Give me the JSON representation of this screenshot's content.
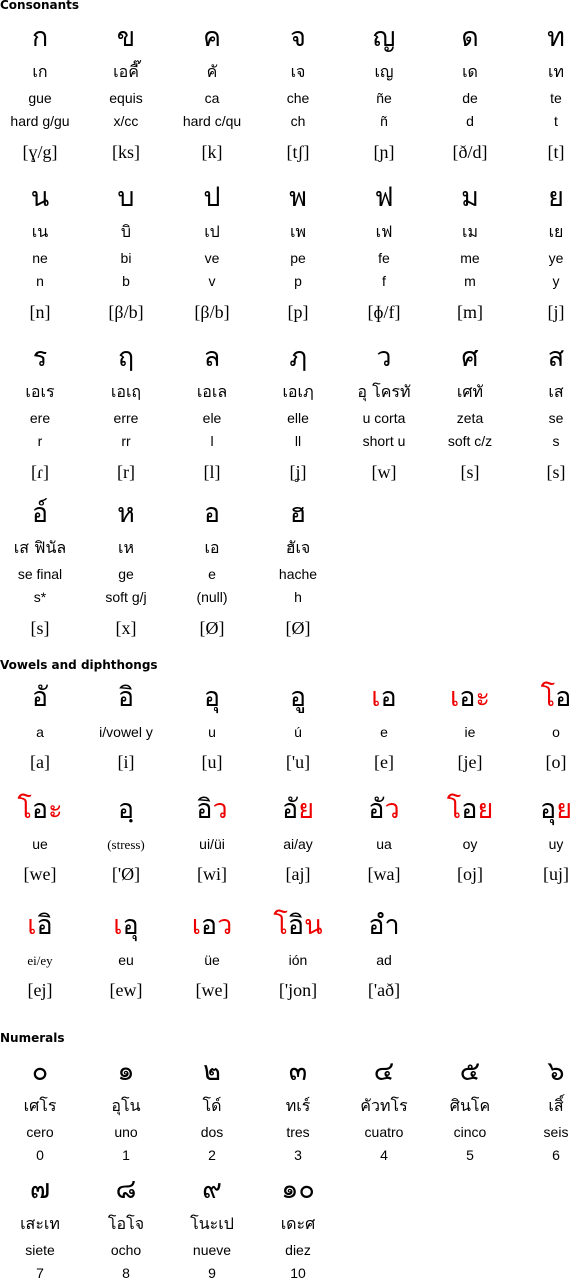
{
  "sections": {
    "consonants": {
      "title": "Consonants",
      "rows": [
        [
          {
            "glyph": "ก",
            "thai_name": "เก",
            "spanish_name": "gue",
            "equivalent": "hard g/gu",
            "ipa": "[ɣ/g]"
          },
          {
            "glyph": "ข",
            "thai_name": "เอคี๊",
            "spanish_name": "equis",
            "equivalent": "x/cc",
            "ipa": "[ks]"
          },
          {
            "glyph": "ค",
            "thai_name": "คั",
            "spanish_name": "ca",
            "equivalent": "hard c/qu",
            "ipa": "[k]"
          },
          {
            "glyph": "จ",
            "thai_name": "เจ",
            "spanish_name": "che",
            "equivalent": "ch",
            "ipa": "[tʃ]"
          },
          {
            "glyph": "ญ",
            "thai_name": "เญ",
            "spanish_name": "ñe",
            "equivalent": "ñ",
            "ipa": "[ɲ]"
          },
          {
            "glyph": "ด",
            "thai_name": "เด",
            "spanish_name": "de",
            "equivalent": "d",
            "ipa": "[ð/d]"
          },
          {
            "glyph": "ท",
            "thai_name": "เท",
            "spanish_name": "te",
            "equivalent": "t",
            "ipa": "[t]"
          }
        ],
        [
          {
            "glyph": "น",
            "thai_name": "เน",
            "spanish_name": "ne",
            "equivalent": "n",
            "ipa": "[n]"
          },
          {
            "glyph": "บ",
            "thai_name": "บิ",
            "spanish_name": "bi",
            "equivalent": "b",
            "ipa": "[β/b]"
          },
          {
            "glyph": "ป",
            "thai_name": "เป",
            "spanish_name": "ve",
            "equivalent": "v",
            "ipa": "[β/b]"
          },
          {
            "glyph": "พ",
            "thai_name": "เพ",
            "spanish_name": "pe",
            "equivalent": "p",
            "ipa": "[p]"
          },
          {
            "glyph": "ฟ",
            "thai_name": "เฟ",
            "spanish_name": "fe",
            "equivalent": "f",
            "ipa": "[ɸ/f]"
          },
          {
            "glyph": "ม",
            "thai_name": "เม",
            "spanish_name": "me",
            "equivalent": "m",
            "ipa": "[m]"
          },
          {
            "glyph": "ย",
            "thai_name": "เย",
            "spanish_name": "ye",
            "equivalent": "y",
            "ipa": "[j]"
          }
        ],
        [
          {
            "glyph": "ร",
            "thai_name": "เอเร",
            "spanish_name": "ere",
            "equivalent": "r",
            "ipa": "[ɾ]"
          },
          {
            "glyph": "ฤ",
            "thai_name": "เอเฤ",
            "spanish_name": "erre",
            "equivalent": "rr",
            "ipa": "[r]"
          },
          {
            "glyph": "ล",
            "thai_name": "เอเล",
            "spanish_name": "ele",
            "equivalent": "l",
            "ipa": "[l]"
          },
          {
            "glyph": "ฦ",
            "thai_name": "เอเฦ",
            "spanish_name": "elle",
            "equivalent": "ll",
            "ipa": "[ʝ]"
          },
          {
            "glyph": "ว",
            "thai_name": "อุ โครทั",
            "spanish_name": "u corta",
            "equivalent": "short u",
            "ipa": "[w]"
          },
          {
            "glyph": "ศ",
            "thai_name": "เศทั",
            "spanish_name": "zeta",
            "equivalent": "soft c/z",
            "ipa": "[s]"
          },
          {
            "glyph": "ส",
            "thai_name": "เส",
            "spanish_name": "se",
            "equivalent": "s",
            "ipa": "[s]"
          }
        ],
        [
          {
            "glyph": "อ์",
            "thai_name": "เส ฟินัล",
            "spanish_name": "se final",
            "equivalent": "s*",
            "ipa": "[s]"
          },
          {
            "glyph": "ห",
            "thai_name": "เห",
            "spanish_name": "ge",
            "equivalent": "soft g/j",
            "ipa": "[x]"
          },
          {
            "glyph": "อ",
            "thai_name": "เอ",
            "spanish_name": "e",
            "equivalent": "(null)",
            "ipa": "[Ø]"
          },
          {
            "glyph": "ฮ",
            "thai_name": "ฮัเจ",
            "spanish_name": "hache",
            "equivalent": "h",
            "ipa": "[Ø]"
          }
        ]
      ]
    },
    "vowels": {
      "title": "Vowels and diphthongs",
      "colors": {
        "base": "#000000",
        "vowel_mark": "#ee0000"
      },
      "rows": [
        [
          {
            "glyph_parts": [
              {
                "t": "อ",
                "red": false
              },
              {
                "t": "ั",
                "red": true
              }
            ],
            "spanish": "a",
            "ipa": "[a]"
          },
          {
            "glyph_parts": [
              {
                "t": "อ",
                "red": false
              },
              {
                "t": "ิ",
                "red": true
              }
            ],
            "spanish": "i/vowel y",
            "ipa": "[i]"
          },
          {
            "glyph_parts": [
              {
                "t": "อ",
                "red": false
              },
              {
                "t": "ุ",
                "red": true
              }
            ],
            "spanish": "u",
            "ipa": "[u]"
          },
          {
            "glyph_parts": [
              {
                "t": "อ",
                "red": false
              },
              {
                "t": "ู",
                "red": true
              }
            ],
            "spanish": "ú",
            "ipa": "['u]"
          },
          {
            "glyph_parts": [
              {
                "t": "เ",
                "red": true
              },
              {
                "t": "อ",
                "red": false
              }
            ],
            "spanish": "e",
            "ipa": "[e]"
          },
          {
            "glyph_parts": [
              {
                "t": "เ",
                "red": true
              },
              {
                "t": "อ",
                "red": false
              },
              {
                "t": "ะ",
                "red": true
              }
            ],
            "spanish": "ie",
            "ipa": "[je]"
          },
          {
            "glyph_parts": [
              {
                "t": "โ",
                "red": true
              },
              {
                "t": "อ",
                "red": false
              }
            ],
            "spanish": "o",
            "ipa": "[o]"
          }
        ],
        [
          {
            "glyph_parts": [
              {
                "t": "โ",
                "red": true
              },
              {
                "t": "อ",
                "red": false
              },
              {
                "t": "ะ",
                "red": true
              }
            ],
            "spanish": "ue",
            "ipa": "[we]"
          },
          {
            "glyph_parts": [
              {
                "t": "อ",
                "red": false
              },
              {
                "t": "ฺ",
                "red": false
              }
            ],
            "spanish": "(stress)",
            "spanish_serif": true,
            "ipa": "['Ø]"
          },
          {
            "glyph_parts": [
              {
                "t": "อ",
                "red": false
              },
              {
                "t": "ิว",
                "red": true
              }
            ],
            "spanish": "ui/üi",
            "ipa": "[wi]"
          },
          {
            "glyph_parts": [
              {
                "t": "อ",
                "red": false
              },
              {
                "t": "ัย",
                "red": true
              }
            ],
            "spanish": "ai/ay",
            "ipa": "[aj]"
          },
          {
            "glyph_parts": [
              {
                "t": "อ",
                "red": false
              },
              {
                "t": "ัว",
                "red": true
              }
            ],
            "spanish": "ua",
            "ipa": "[wa]"
          },
          {
            "glyph_parts": [
              {
                "t": "โ",
                "red": true
              },
              {
                "t": "อ",
                "red": false
              },
              {
                "t": "ย",
                "red": true
              }
            ],
            "spanish": "oy",
            "ipa": "[oj]"
          },
          {
            "glyph_parts": [
              {
                "t": "อ",
                "red": false
              },
              {
                "t": "ุย",
                "red": true
              }
            ],
            "spanish": "uy",
            "ipa": "[uj]"
          }
        ],
        [
          {
            "glyph_parts": [
              {
                "t": "เ",
                "red": true
              },
              {
                "t": "อ",
                "red": false
              },
              {
                "t": "ิ",
                "red": true
              }
            ],
            "spanish": "ei/ey",
            "spanish_serif": true,
            "ipa": "[ej]"
          },
          {
            "glyph_parts": [
              {
                "t": "เ",
                "red": true
              },
              {
                "t": "อ",
                "red": false
              },
              {
                "t": "ุ",
                "red": true
              }
            ],
            "spanish": "eu",
            "ipa": "[ew]"
          },
          {
            "glyph_parts": [
              {
                "t": "เ",
                "red": true
              },
              {
                "t": "อ",
                "red": false
              },
              {
                "t": "ว",
                "red": true
              }
            ],
            "spanish": "üe",
            "ipa": "[we]"
          },
          {
            "glyph_parts": [
              {
                "t": "โ",
                "red": true
              },
              {
                "t": "อ",
                "red": false
              },
              {
                "t": "ิน",
                "red": true
              }
            ],
            "spanish": "ión",
            "ipa": "['jon]"
          },
          {
            "glyph_parts": [
              {
                "t": "อ",
                "red": false
              },
              {
                "t": "ำ",
                "red": true
              }
            ],
            "spanish": "ad",
            "ipa": "['að]"
          }
        ]
      ]
    },
    "numerals": {
      "title": "Numerals",
      "rows": [
        [
          {
            "glyph": "๐",
            "thai_name": "เศโร",
            "spanish": "cero",
            "value": "0"
          },
          {
            "glyph": "๑",
            "thai_name": "อุโน",
            "spanish": "uno",
            "value": "1"
          },
          {
            "glyph": "๒",
            "thai_name": "โด์",
            "spanish": "dos",
            "value": "2"
          },
          {
            "glyph": "๓",
            "thai_name": "ทเร์",
            "spanish": "tres",
            "value": "3"
          },
          {
            "glyph": "๔",
            "thai_name": "คัวทโร",
            "spanish": "cuatro",
            "value": "4"
          },
          {
            "glyph": "๕",
            "thai_name": "ศินโค",
            "spanish": "cinco",
            "value": "5"
          },
          {
            "glyph": "๖",
            "thai_name": "เสิ์",
            "spanish": "seis",
            "value": "6"
          }
        ],
        [
          {
            "glyph": "๗",
            "thai_name": "เสะเท",
            "spanish": "siete",
            "value": "7"
          },
          {
            "glyph": "๘",
            "thai_name": "โอโจ",
            "spanish": "ocho",
            "value": "8"
          },
          {
            "glyph": "๙",
            "thai_name": "โนะเป",
            "spanish": "nueve",
            "value": "9"
          },
          {
            "glyph": "๑๐",
            "thai_name": "เดะศ",
            "spanish": "diez",
            "value": "10"
          }
        ]
      ]
    }
  }
}
